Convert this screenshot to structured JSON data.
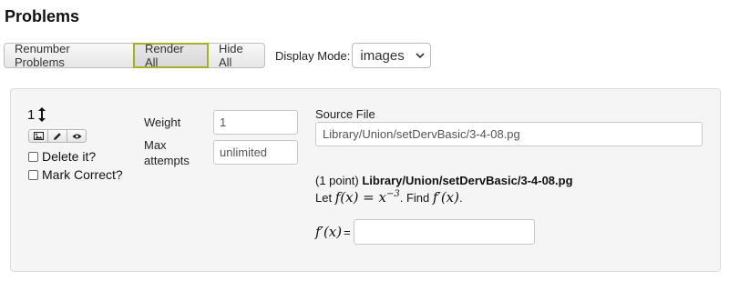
{
  "page": {
    "title": "Problems"
  },
  "toolbar": {
    "renumber_label": "Renumber Problems",
    "render_all_label": "Render All",
    "hide_all_label": "Hide All",
    "display_mode_label": "Display Mode:",
    "display_mode_value": "images"
  },
  "problem": {
    "number": "1",
    "delete_label": "Delete it?",
    "mark_correct_label": "Mark Correct?",
    "weight_label": "Weight",
    "weight_value": "1",
    "max_attempts_label_line1": "Max",
    "max_attempts_label_line2": "attempts",
    "max_attempts_value": "unlimited",
    "source_file_label": "Source File",
    "source_file_value": "Library/Union/setDervBasic/3-4-08.pg",
    "points_text": "(1 point)",
    "header_path": "Library/Union/setDervBasic/3-4-08.pg",
    "statement_let": "Let",
    "statement_math1": "f(x) = x",
    "statement_exponent": "−3",
    "statement_find": ". Find",
    "statement_math2": "f′(x)",
    "statement_end": ".",
    "answer_math": "f′(x)",
    "answer_equals": "=",
    "answer_value": ""
  },
  "colors": {
    "active_border": "#a8ad2a",
    "panel_bg": "#f5f5f5"
  },
  "icons": [
    "arrows-vertical-icon",
    "image-icon",
    "pencil-icon",
    "eye-icon",
    "chevron-down-icon"
  ]
}
